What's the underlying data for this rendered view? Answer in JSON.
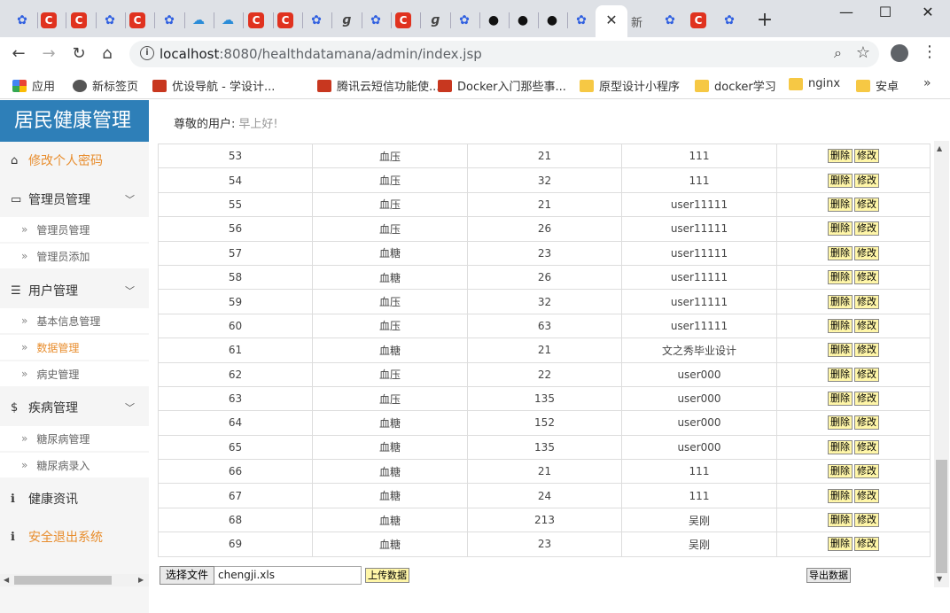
{
  "browser": {
    "tabs": {
      "icons": [
        "baidu-icon",
        "csdn-icon",
        "csdn-icon",
        "baidu-icon",
        "csdn-icon",
        "baidu-icon",
        "cloud-icon",
        "cloud-icon",
        "csdn-icon",
        "csdn-icon",
        "baidu-icon",
        "g-icon",
        "baidu-icon",
        "csdn-icon",
        "g-icon",
        "baidu-icon",
        "github-icon",
        "github-icon",
        "github-icon",
        "baidu-icon"
      ],
      "active_close": "✕",
      "new_tab_label": "新",
      "trailing_icons": [
        "baidu-icon",
        "csdn-icon",
        "baidu-icon"
      ]
    },
    "window": {
      "minimize": "—",
      "maximize": "☐",
      "close": "✕"
    },
    "nav": {
      "back": "←",
      "forward": "→",
      "reload": "↻",
      "home": "⌂"
    },
    "address": {
      "host": "localhost",
      "rest": ":8080/healthdatamana/admin/index.jsp"
    },
    "bookmarks": [
      {
        "label": "应用",
        "icon": "apps-icon"
      },
      {
        "label": "新标签页",
        "icon": "globe-icon"
      },
      {
        "label": "优设导航 - 学设计...",
        "icon": "uisdc-icon"
      },
      {
        "label": "腾讯云短信功能使...",
        "icon": "csdn-icon"
      },
      {
        "label": "Docker入门那些事...",
        "icon": "csdn-icon"
      },
      {
        "label": "原型设计小程序",
        "icon": "folder-icon"
      },
      {
        "label": "docker学习",
        "icon": "folder-icon"
      },
      {
        "label": "nginx",
        "icon": "folder-icon"
      },
      {
        "label": "安卓",
        "icon": "folder-icon"
      }
    ],
    "bookmarks_more": "»"
  },
  "sidebar": {
    "brand": "居民健康管理",
    "change_password": "修改个人密码",
    "groups": [
      {
        "label": "管理员管理",
        "items": [
          "管理员管理",
          "管理员添加"
        ]
      },
      {
        "label": "用户管理",
        "items": [
          "基本信息管理",
          "数据管理",
          "病史管理"
        ]
      },
      {
        "label": "疾病管理",
        "items": [
          "糖尿病管理",
          "糖尿病录入"
        ]
      }
    ],
    "health_info": "健康资讯",
    "logout": "安全退出系统"
  },
  "header": {
    "greeting_label": "尊敬的用户:",
    "greeting_value": "早上好!"
  },
  "table": {
    "rows": [
      [
        "53",
        "血压",
        "21",
        "111"
      ],
      [
        "54",
        "血压",
        "32",
        "111"
      ],
      [
        "55",
        "血压",
        "21",
        "user11111"
      ],
      [
        "56",
        "血压",
        "26",
        "user11111"
      ],
      [
        "57",
        "血糖",
        "23",
        "user11111"
      ],
      [
        "58",
        "血糖",
        "26",
        "user11111"
      ],
      [
        "59",
        "血压",
        "32",
        "user11111"
      ],
      [
        "60",
        "血压",
        "63",
        "user11111"
      ],
      [
        "61",
        "血糖",
        "21",
        "文之秀毕业设计"
      ],
      [
        "62",
        "血压",
        "22",
        "user000"
      ],
      [
        "63",
        "血压",
        "135",
        "user000"
      ],
      [
        "64",
        "血糖",
        "152",
        "user000"
      ],
      [
        "65",
        "血糖",
        "135",
        "user000"
      ],
      [
        "66",
        "血糖",
        "21",
        "111"
      ],
      [
        "67",
        "血糖",
        "24",
        "111"
      ],
      [
        "68",
        "血糖",
        "213",
        "吴刚"
      ],
      [
        "69",
        "血糖",
        "23",
        "吴刚"
      ]
    ],
    "delete_label": "删除",
    "edit_label": "修改"
  },
  "upload": {
    "choose_file_label": "选择文件",
    "file_name": "chengji.xls",
    "upload_label": "上传数据",
    "export_label": "导出数据"
  }
}
